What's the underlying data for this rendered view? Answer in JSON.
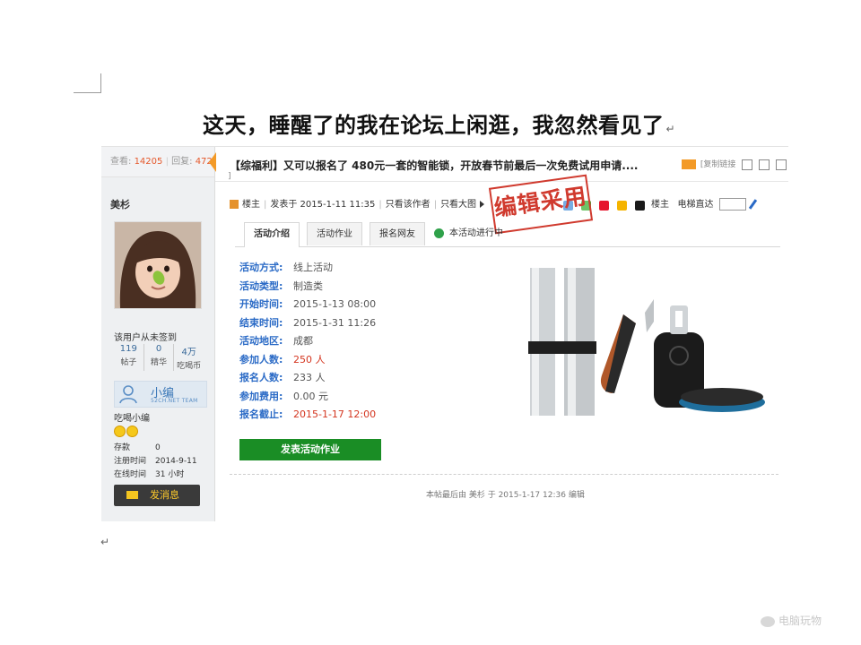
{
  "document": {
    "heading": "这天，睡醒了的我在论坛上闲逛，我忽然看见了",
    "paragraph_mark": "↵"
  },
  "sidebar": {
    "views_label": "查看:",
    "views": "14205",
    "replies_label": "回复:",
    "replies": "472",
    "author": "美杉",
    "signin_text": "该用户从未签到",
    "stats": [
      {
        "value": "119",
        "label": "帖子"
      },
      {
        "value": "0",
        "label": "精华"
      },
      {
        "value": "4万",
        "label": "吃喝币"
      }
    ],
    "team_name": "小编",
    "team_tag": "52CH.NET TEAM",
    "user_title": "吃喝小编",
    "info": [
      {
        "key": "存款",
        "value": "0"
      },
      {
        "key": "注册时间",
        "value": "2014-9-11"
      },
      {
        "key": "在线时间",
        "value": "31 小时"
      }
    ],
    "message_button": "发消息"
  },
  "post": {
    "title": "【综福利】又可以报名了 480元一套的智能锁，开放春节前最后一次免费试用申请....",
    "title_wrap": "]",
    "copy_link": "[复制链接",
    "owner_label": "楼主",
    "posted_at": "发表于 2015-1-11 11:35",
    "only_author": "只看该作者",
    "view_big": "只看大图",
    "right_owner": "楼主",
    "elevator": "电梯直达",
    "stamp": "编辑采用"
  },
  "tabs": {
    "items": [
      "活动介绍",
      "活动作业",
      "报名网友"
    ],
    "active_index": 0,
    "status": "本活动进行中"
  },
  "activity": {
    "fields": [
      {
        "key": "活动方式:",
        "value": "线上活动",
        "highlight": false
      },
      {
        "key": "活动类型:",
        "value": "制造类",
        "highlight": false
      },
      {
        "key": "开始时间:",
        "value": "2015-1-13 08:00",
        "highlight": false
      },
      {
        "key": "结束时间:",
        "value": "2015-1-31 11:26",
        "highlight": false
      },
      {
        "key": "活动地区:",
        "value": "成都",
        "highlight": false
      },
      {
        "key": "参加人数:",
        "value": "250 人",
        "highlight": true
      },
      {
        "key": "报名人数:",
        "value": "233 人",
        "highlight": false
      },
      {
        "key": "参加费用:",
        "value": "0.00 元",
        "highlight": false
      },
      {
        "key": "报名截止:",
        "value": "2015-1-17 12:00",
        "highlight": true
      }
    ],
    "submit_button": "发表活动作业"
  },
  "footer": {
    "edit_note": "本帖最后由 美杉 于 2015-1-17 12:36 编辑"
  },
  "watermark": "电脑玩物",
  "colors": {
    "field_label": "#2a6ac6",
    "highlight": "#d4351f",
    "submit_green": "#1a8d25",
    "stamp_red": "#d03a2e",
    "accent_orange": "#f39a27"
  }
}
